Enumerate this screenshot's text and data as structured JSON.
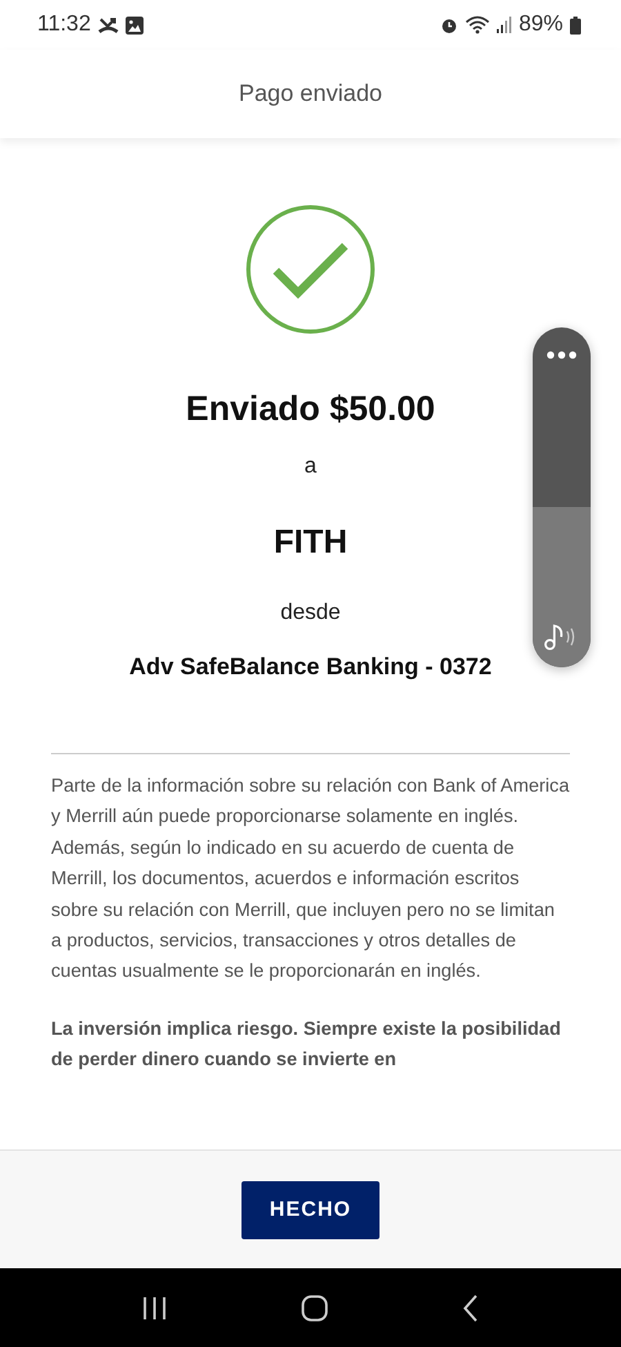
{
  "status_bar": {
    "time": "11:32",
    "battery": "89%"
  },
  "header": {
    "title": "Pago enviado"
  },
  "confirmation": {
    "amount_line": "Enviado $50.00",
    "to_word": "a",
    "recipient": "FITH",
    "from_word": "desde",
    "account": "Adv SafeBalance Banking - 0372"
  },
  "volume_panel": {
    "level": 0.47
  },
  "disclosures": [
    {
      "kind": "normal",
      "text": "Parte de la información sobre su relación con Bank of America y Merrill aún puede proporcionarse solamente en inglés. Además, según lo indicado en su acuerdo de cuenta de Merrill, los documentos, acuerdos e información escritos sobre su relación con Merrill, que incluyen pero no se limitan a productos, servicios, transacciones y otros detalles de cuentas usualmente se le proporcionarán en inglés."
    },
    {
      "kind": "bold",
      "text": "La inversión implica riesgo. Siempre existe la posibilidad de perder dinero cuando se invierte en"
    }
  ],
  "footer": {
    "button": "HECHO"
  }
}
